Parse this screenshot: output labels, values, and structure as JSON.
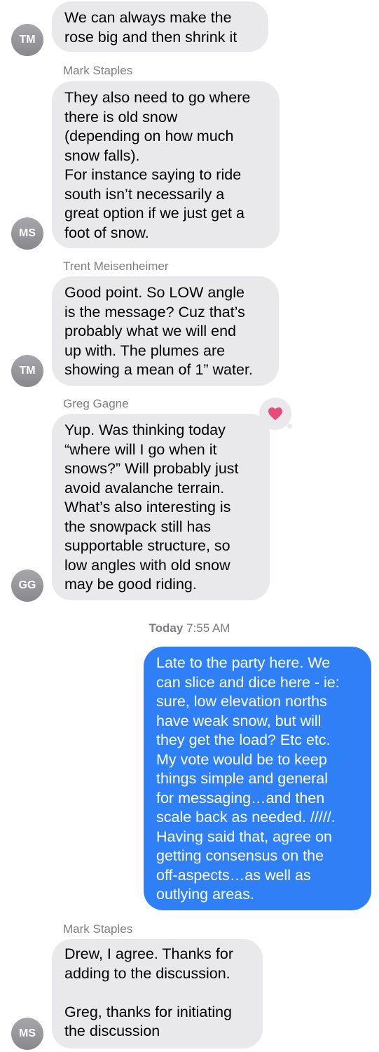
{
  "messages": [
    {
      "avatar": "TM",
      "text": "We can always make the\nrose big and then shrink it"
    },
    {
      "sender": "Mark Staples",
      "avatar": "MS",
      "text": "They also need to go where\nthere is old snow\n(depending on how much\nsnow falls).\nFor instance saying to ride\nsouth isn’t necessarily a\ngreat option if we just get a\nfoot of snow."
    },
    {
      "sender": "Trent Meisenheimer",
      "avatar": "TM",
      "text": "Good point. So LOW angle\nis the message? Cuz that’s\nprobably what we will end\nup with. The plumes are\nshowing a mean of 1” water."
    },
    {
      "sender": "Greg Gagne",
      "avatar": "GG",
      "reaction": "heart-icon",
      "text": "Yup. Was thinking today\n“where will I go when it\nsnows?” Will probably just\navoid avalanche terrain.\nWhat’s also interesting is\nthe snowpack still has\nsupportable structure, so\nlow angles with old snow\nmay be good riding."
    },
    {
      "timestamp_day": "Today",
      "timestamp_time": "7:55 AM"
    },
    {
      "outgoing": true,
      "text": "Late to the party here.  We\ncan slice and dice here - ie:\nsure, low elevation norths\nhave weak snow, but will\nthey get the load?  Etc etc.\nMy vote would be to keep\nthings simple and general\nfor messaging…and then\nscale back as needed.  /////.\nHaving said that, agree on\ngetting consensus on the\noff-aspects…as well as\noutlying areas."
    },
    {
      "sender": "Mark Staples",
      "avatar": "MS",
      "text": "Drew, I agree. Thanks for\nadding to the discussion.\n\nGreg, thanks for initiating\nthe discussion"
    }
  ],
  "colors": {
    "incoming_bubble": "#e9e9eb",
    "outgoing_bubble": "#2f80f6",
    "sender_label": "#7d7d82",
    "heart": "#ea4a7a"
  }
}
